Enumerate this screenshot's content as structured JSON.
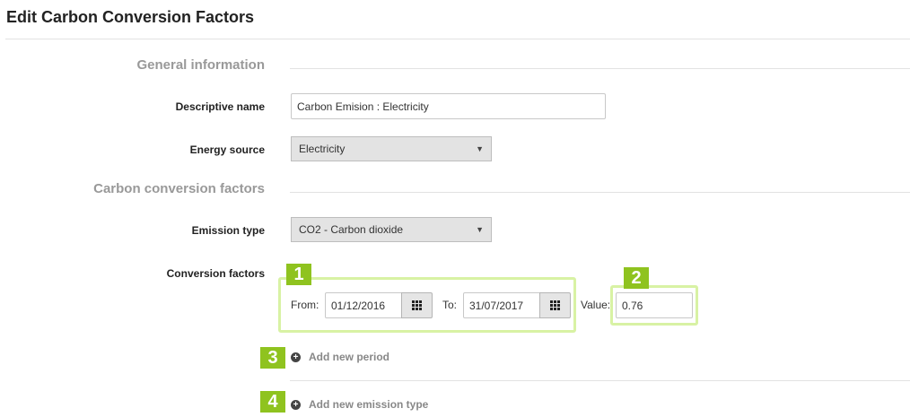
{
  "page": {
    "title": "Edit Carbon Conversion Factors"
  },
  "general": {
    "heading": "General information",
    "descriptive_name": {
      "label": "Descriptive name",
      "value": "Carbon Emision : Electricity"
    },
    "energy_source": {
      "label": "Energy source",
      "value": "Electricity"
    }
  },
  "factors": {
    "heading": "Carbon conversion factors",
    "emission_type": {
      "label": "Emission type",
      "value": "CO2 - Carbon dioxide"
    },
    "conversion": {
      "label": "Conversion factors",
      "from_label": "From:",
      "from_value": "01/12/2016",
      "to_label": "To:",
      "to_value": "31/07/2017",
      "value_label": "Value:",
      "value": "0.76"
    },
    "add_period": "Add new period",
    "add_emission": "Add new emission type"
  },
  "badges": [
    "1",
    "2",
    "3",
    "4"
  ],
  "colors": {
    "badge": "#8fc31f",
    "highlight": "#d8f2a4"
  },
  "icons": {
    "calendar": "calendar-grid-icon",
    "add": "plus-circle-icon",
    "dropdown": "caret-down-icon"
  }
}
